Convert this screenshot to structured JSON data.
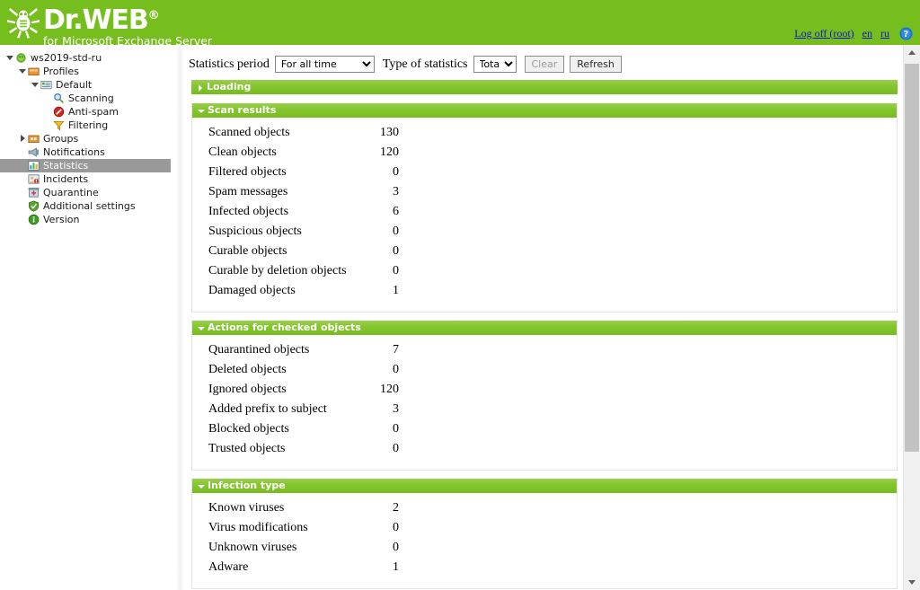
{
  "header": {
    "brand_title": "Dr.WEB",
    "brand_reg": "®",
    "brand_subtitle": "for Microsoft Exchange Server",
    "logoff_label": "Log off (root)",
    "lang_en": "en",
    "lang_ru": "ru",
    "help_icon": "help-icon",
    "bg_color": "#76be1d"
  },
  "sidebar": {
    "items": [
      {
        "label": "ws2019-std-ru",
        "icon": "server-spider-icon",
        "depth": 0,
        "twist": "open",
        "selected": false
      },
      {
        "label": "Profiles",
        "icon": "folder-icon",
        "depth": 1,
        "twist": "open",
        "selected": false
      },
      {
        "label": "Default",
        "icon": "profile-icon",
        "depth": 2,
        "twist": "open",
        "selected": false
      },
      {
        "label": "Scanning",
        "icon": "magnifier-icon",
        "depth": 3,
        "twist": "none",
        "selected": false
      },
      {
        "label": "Anti-spam",
        "icon": "no-entry-icon",
        "depth": 3,
        "twist": "none",
        "selected": false
      },
      {
        "label": "Filtering",
        "icon": "funnel-icon",
        "depth": 3,
        "twist": "none",
        "selected": false
      },
      {
        "label": "Groups",
        "icon": "groups-icon",
        "depth": 1,
        "twist": "closed",
        "selected": false
      },
      {
        "label": "Notifications",
        "icon": "megaphone-icon",
        "depth": 1,
        "twist": "none",
        "selected": false
      },
      {
        "label": "Statistics",
        "icon": "bar-chart-icon",
        "depth": 1,
        "twist": "none",
        "selected": true
      },
      {
        "label": "Incidents",
        "icon": "incidents-icon",
        "depth": 1,
        "twist": "none",
        "selected": false
      },
      {
        "label": "Quarantine",
        "icon": "quarantine-icon",
        "depth": 1,
        "twist": "none",
        "selected": false
      },
      {
        "label": "Additional settings",
        "icon": "shield-icon",
        "depth": 1,
        "twist": "none",
        "selected": false
      },
      {
        "label": "Version",
        "icon": "info-icon",
        "depth": 1,
        "twist": "none",
        "selected": false
      }
    ]
  },
  "toolbar": {
    "period_label": "Statistics period",
    "period_value": "For all time",
    "period_options": [
      "For all time"
    ],
    "type_label": "Type of statistics",
    "type_value": "Total",
    "type_options": [
      "Total"
    ],
    "clear_label": "Clear",
    "clear_disabled": true,
    "refresh_label": "Refresh",
    "refresh_disabled": false
  },
  "sections": [
    {
      "title": "Loading",
      "state": "closed",
      "rows": []
    },
    {
      "title": "Scan results",
      "state": "open",
      "rows": [
        {
          "key": "Scanned objects",
          "value": "130"
        },
        {
          "key": "Clean objects",
          "value": "120"
        },
        {
          "key": "Filtered objects",
          "value": "0"
        },
        {
          "key": "Spam messages",
          "value": "3"
        },
        {
          "key": "Infected objects",
          "value": "6"
        },
        {
          "key": "Suspicious objects",
          "value": "0"
        },
        {
          "key": "Curable objects",
          "value": "0"
        },
        {
          "key": "Curable by deletion objects",
          "value": "0"
        },
        {
          "key": "Damaged objects",
          "value": "1"
        }
      ]
    },
    {
      "title": "Actions for checked objects",
      "state": "open",
      "rows": [
        {
          "key": "Quarantined objects",
          "value": "7"
        },
        {
          "key": "Deleted objects",
          "value": "0"
        },
        {
          "key": "Ignored objects",
          "value": "120"
        },
        {
          "key": "Added prefix to subject",
          "value": "3"
        },
        {
          "key": "Blocked objects",
          "value": "0"
        },
        {
          "key": "Trusted objects",
          "value": "0"
        }
      ]
    },
    {
      "title": "Infection type",
      "state": "open",
      "rows": [
        {
          "key": "Known viruses",
          "value": "2"
        },
        {
          "key": "Virus modifications",
          "value": "0"
        },
        {
          "key": "Unknown viruses",
          "value": "0"
        },
        {
          "key": "Adware",
          "value": "1"
        }
      ]
    }
  ],
  "scrollbar": {
    "up_icon": "scroll-up-icon",
    "down_icon": "scroll-down-icon"
  }
}
